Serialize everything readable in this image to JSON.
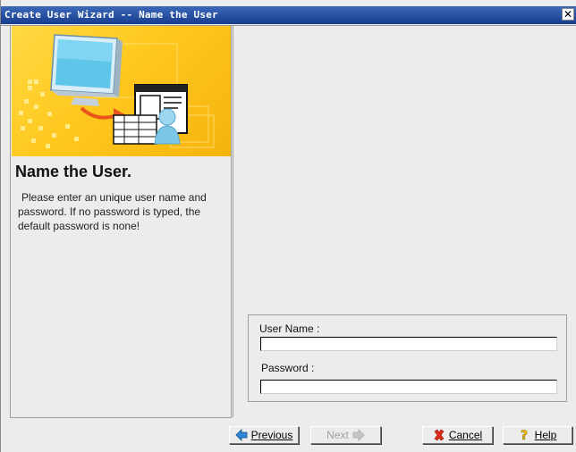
{
  "window": {
    "title": "Create User Wizard -- Name the User"
  },
  "left": {
    "heading": "Name the User.",
    "description": "Please enter an unique user name and password. If no password is typed, the default password is none!"
  },
  "form": {
    "user_name_label": "User Name :",
    "user_name_value": "",
    "password_label": "Password :",
    "password_value": ""
  },
  "buttons": {
    "previous": "Previous",
    "next": "Next",
    "cancel": "Cancel",
    "help": "Help"
  },
  "colors": {
    "titlebar": "#173d8f",
    "banner": "#ffc81e",
    "background": "#ececec"
  },
  "icons": {
    "close": "close-icon",
    "previous": "arrow-left-icon",
    "next": "arrow-right-icon",
    "cancel": "red-x-icon",
    "help": "question-icon"
  }
}
